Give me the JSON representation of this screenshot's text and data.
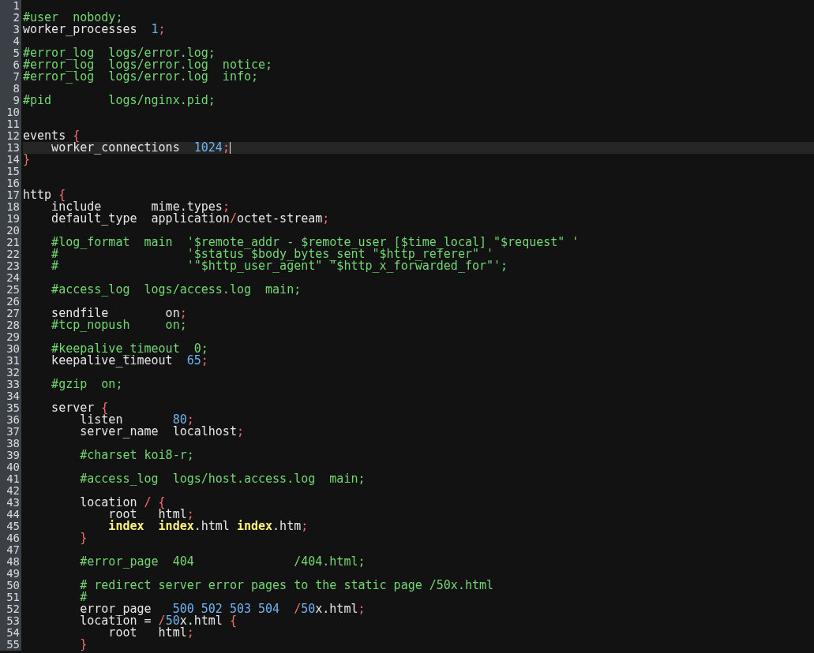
{
  "editor": {
    "lines": [
      {
        "number": "1"
      },
      {
        "number": "2",
        "tokens": [
          {
            "kind": "comment",
            "text": "#user  nobody;"
          }
        ]
      },
      {
        "number": "3",
        "tokens": [
          {
            "kind": "plain",
            "text": "worker_processes  "
          },
          {
            "kind": "number",
            "text": "1"
          },
          {
            "kind": "punct",
            "text": ";"
          }
        ]
      },
      {
        "number": "4"
      },
      {
        "number": "5",
        "tokens": [
          {
            "kind": "comment",
            "text": "#error_log  logs/error.log;"
          }
        ]
      },
      {
        "number": "6",
        "tokens": [
          {
            "kind": "comment",
            "text": "#error_log  logs/error.log  notice;"
          }
        ]
      },
      {
        "number": "7",
        "tokens": [
          {
            "kind": "comment",
            "text": "#error_log  logs/error.log  info;"
          }
        ]
      },
      {
        "number": "8"
      },
      {
        "number": "9",
        "tokens": [
          {
            "kind": "comment",
            "text": "#pid        logs/nginx.pid;"
          }
        ]
      },
      {
        "number": "10"
      },
      {
        "number": "11"
      },
      {
        "number": "12",
        "tokens": [
          {
            "kind": "plain",
            "text": "events "
          },
          {
            "kind": "punct",
            "text": "{"
          }
        ]
      },
      {
        "number": "13",
        "current": true,
        "tokens": [
          {
            "kind": "plain",
            "text": "    worker_connections  "
          },
          {
            "kind": "number",
            "text": "1024"
          },
          {
            "kind": "punct",
            "text": ";"
          }
        ]
      },
      {
        "number": "14",
        "tokens": [
          {
            "kind": "punct",
            "text": "}"
          }
        ]
      },
      {
        "number": "15"
      },
      {
        "number": "16"
      },
      {
        "number": "17",
        "tokens": [
          {
            "kind": "plain",
            "text": "http "
          },
          {
            "kind": "punct",
            "text": "{"
          }
        ]
      },
      {
        "number": "18",
        "tokens": [
          {
            "kind": "plain",
            "text": "    include       mime.types"
          },
          {
            "kind": "punct",
            "text": ";"
          }
        ]
      },
      {
        "number": "19",
        "tokens": [
          {
            "kind": "plain",
            "text": "    default_type  application"
          },
          {
            "kind": "punct",
            "text": "/"
          },
          {
            "kind": "plain",
            "text": "octet-stream"
          },
          {
            "kind": "punct",
            "text": ";"
          }
        ]
      },
      {
        "number": "20"
      },
      {
        "number": "21",
        "tokens": [
          {
            "kind": "comment",
            "text": "    #log_format  main  '$remote_addr - $remote_user [$time_local] \"$request\" '"
          }
        ]
      },
      {
        "number": "22",
        "tokens": [
          {
            "kind": "comment",
            "text": "    #                  '$status $body_bytes_sent \"$http_referer\" '"
          }
        ]
      },
      {
        "number": "23",
        "tokens": [
          {
            "kind": "comment",
            "text": "    #                  '\"$http_user_agent\" \"$http_x_forwarded_for\"';"
          }
        ]
      },
      {
        "number": "24"
      },
      {
        "number": "25",
        "tokens": [
          {
            "kind": "comment",
            "text": "    #access_log  logs/access.log  main;"
          }
        ]
      },
      {
        "number": "26"
      },
      {
        "number": "27",
        "tokens": [
          {
            "kind": "plain",
            "text": "    sendfile        on"
          },
          {
            "kind": "punct",
            "text": ";"
          }
        ]
      },
      {
        "number": "28",
        "tokens": [
          {
            "kind": "comment",
            "text": "    #tcp_nopush     on;"
          }
        ]
      },
      {
        "number": "29"
      },
      {
        "number": "30",
        "tokens": [
          {
            "kind": "comment",
            "text": "    #keepalive_timeout  0;"
          }
        ]
      },
      {
        "number": "31",
        "tokens": [
          {
            "kind": "plain",
            "text": "    keepalive_timeout  "
          },
          {
            "kind": "number",
            "text": "65"
          },
          {
            "kind": "punct",
            "text": ";"
          }
        ]
      },
      {
        "number": "32"
      },
      {
        "number": "33",
        "tokens": [
          {
            "kind": "comment",
            "text": "    #gzip  on;"
          }
        ]
      },
      {
        "number": "34"
      },
      {
        "number": "35",
        "tokens": [
          {
            "kind": "plain",
            "text": "    server "
          },
          {
            "kind": "punct",
            "text": "{"
          }
        ]
      },
      {
        "number": "36",
        "tokens": [
          {
            "kind": "plain",
            "text": "        listen       "
          },
          {
            "kind": "number",
            "text": "80"
          },
          {
            "kind": "punct",
            "text": ";"
          }
        ]
      },
      {
        "number": "37",
        "tokens": [
          {
            "kind": "plain",
            "text": "        server_name  localhost"
          },
          {
            "kind": "punct",
            "text": ";"
          }
        ]
      },
      {
        "number": "38"
      },
      {
        "number": "39",
        "tokens": [
          {
            "kind": "comment",
            "text": "        #charset koi8-r;"
          }
        ]
      },
      {
        "number": "40"
      },
      {
        "number": "41",
        "tokens": [
          {
            "kind": "comment",
            "text": "        #access_log  logs/host.access.log  main;"
          }
        ]
      },
      {
        "number": "42"
      },
      {
        "number": "43",
        "tokens": [
          {
            "kind": "plain",
            "text": "        location "
          },
          {
            "kind": "punct",
            "text": "/ {"
          }
        ]
      },
      {
        "number": "44",
        "tokens": [
          {
            "kind": "plain",
            "text": "            root   html"
          },
          {
            "kind": "punct",
            "text": ";"
          }
        ]
      },
      {
        "number": "45",
        "tokens": [
          {
            "kind": "keyword",
            "text": "            index  "
          },
          {
            "kind": "keyword",
            "text": "index"
          },
          {
            "kind": "plain",
            "text": ".html "
          },
          {
            "kind": "keyword",
            "text": "index"
          },
          {
            "kind": "plain",
            "text": ".htm"
          },
          {
            "kind": "punct",
            "text": ";"
          }
        ]
      },
      {
        "number": "46",
        "tokens": [
          {
            "kind": "punct",
            "text": "        }"
          }
        ]
      },
      {
        "number": "47"
      },
      {
        "number": "48",
        "tokens": [
          {
            "kind": "comment",
            "text": "        #error_page  404              /404.html;"
          }
        ]
      },
      {
        "number": "49"
      },
      {
        "number": "50",
        "tokens": [
          {
            "kind": "comment",
            "text": "        # redirect server error pages to the static page /50x.html"
          }
        ]
      },
      {
        "number": "51",
        "tokens": [
          {
            "kind": "comment",
            "text": "        #"
          }
        ]
      },
      {
        "number": "52",
        "tokens": [
          {
            "kind": "plain",
            "text": "        error_page   "
          },
          {
            "kind": "number",
            "text": "500 502 503 504  "
          },
          {
            "kind": "punct",
            "text": "/"
          },
          {
            "kind": "number",
            "text": "50"
          },
          {
            "kind": "plain",
            "text": "x.html"
          },
          {
            "kind": "punct",
            "text": ";"
          }
        ]
      },
      {
        "number": "53",
        "tokens": [
          {
            "kind": "plain",
            "text": "        location = "
          },
          {
            "kind": "punct",
            "text": "/"
          },
          {
            "kind": "number",
            "text": "50"
          },
          {
            "kind": "plain",
            "text": "x.html "
          },
          {
            "kind": "punct",
            "text": "{"
          }
        ]
      },
      {
        "number": "54",
        "tokens": [
          {
            "kind": "plain",
            "text": "            root   html"
          },
          {
            "kind": "punct",
            "text": ";"
          }
        ]
      },
      {
        "number": "55",
        "tokens": [
          {
            "kind": "punct",
            "text": "        }"
          }
        ]
      }
    ]
  }
}
